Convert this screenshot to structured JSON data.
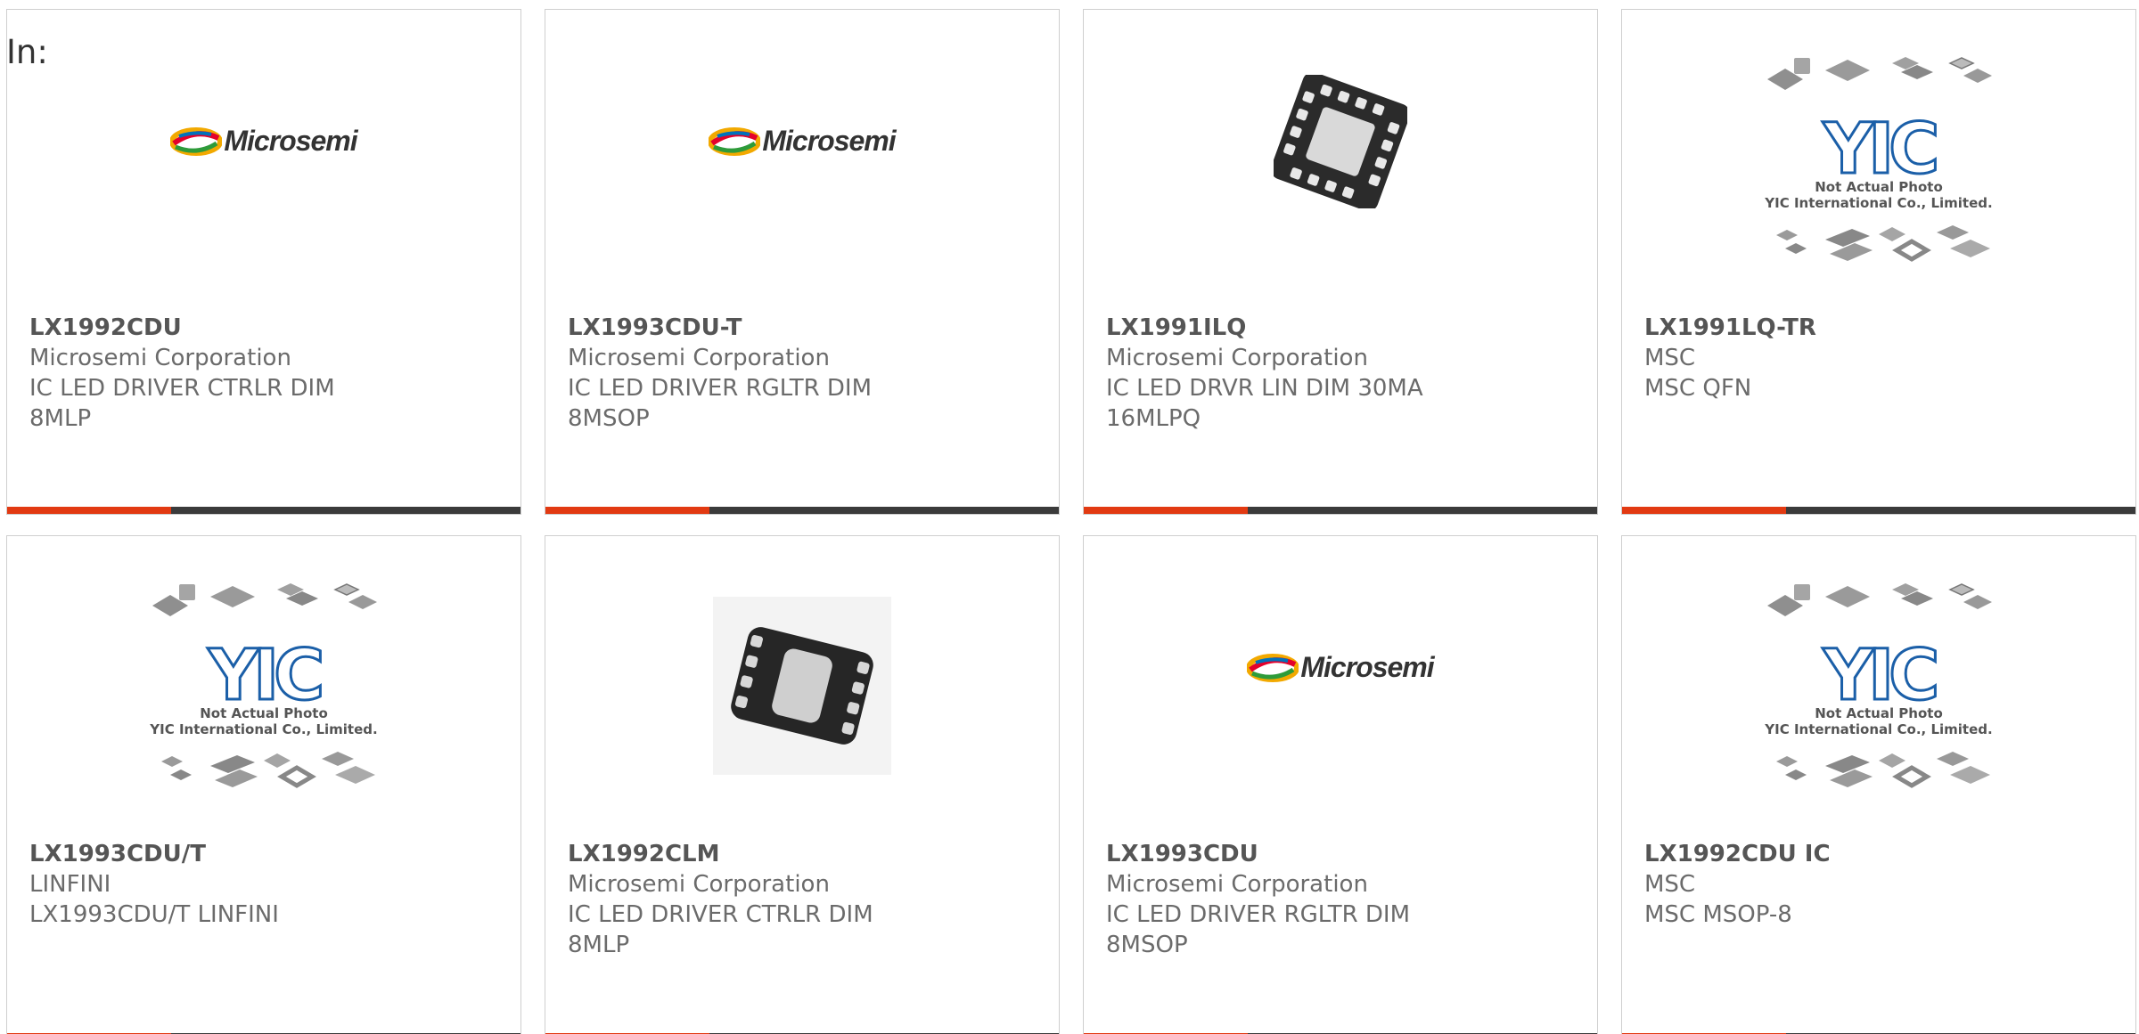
{
  "header": {
    "in_label": "In:"
  },
  "placeholder": {
    "line1": "Not Actual Photo",
    "line2": "YIC International Co., Limited.",
    "brand": "YIC"
  },
  "microsemi_logo_text": "Microsemi",
  "colors": {
    "accent": "#e23a12",
    "bar": "#3b3b3b",
    "border": "#cfcfcf"
  },
  "products": [
    {
      "part": "LX1992CDU",
      "maker": "Microsemi Corporation",
      "desc": "IC LED DRIVER CTRLR DIM 8MLP",
      "image": "microsemi-logo"
    },
    {
      "part": "LX1993CDU-T",
      "maker": "Microsemi Corporation",
      "desc": "IC LED DRIVER RGLTR DIM 8MSOP",
      "image": "microsemi-logo"
    },
    {
      "part": "LX1991ILQ",
      "maker": "Microsemi Corporation",
      "desc": "IC LED DRVR LIN DIM 30MA 16MLPQ",
      "image": "qfn-chip"
    },
    {
      "part": "LX1991LQ-TR",
      "maker": "MSC",
      "desc": "MSC QFN",
      "image": "yic-placeholder"
    },
    {
      "part": "LX1993CDU/T",
      "maker": "LINFINI",
      "desc": "LX1993CDU/T LINFINI",
      "image": "yic-placeholder"
    },
    {
      "part": "LX1992CLM",
      "maker": "Microsemi Corporation",
      "desc": "IC LED DRIVER CTRLR DIM 8MLP",
      "image": "dfn-chip"
    },
    {
      "part": "LX1993CDU",
      "maker": "Microsemi Corporation",
      "desc": "IC LED DRIVER RGLTR DIM 8MSOP",
      "image": "microsemi-logo"
    },
    {
      "part": "LX1992CDU IC",
      "maker": "MSC",
      "desc": "MSC MSOP-8",
      "image": "yic-placeholder"
    }
  ]
}
